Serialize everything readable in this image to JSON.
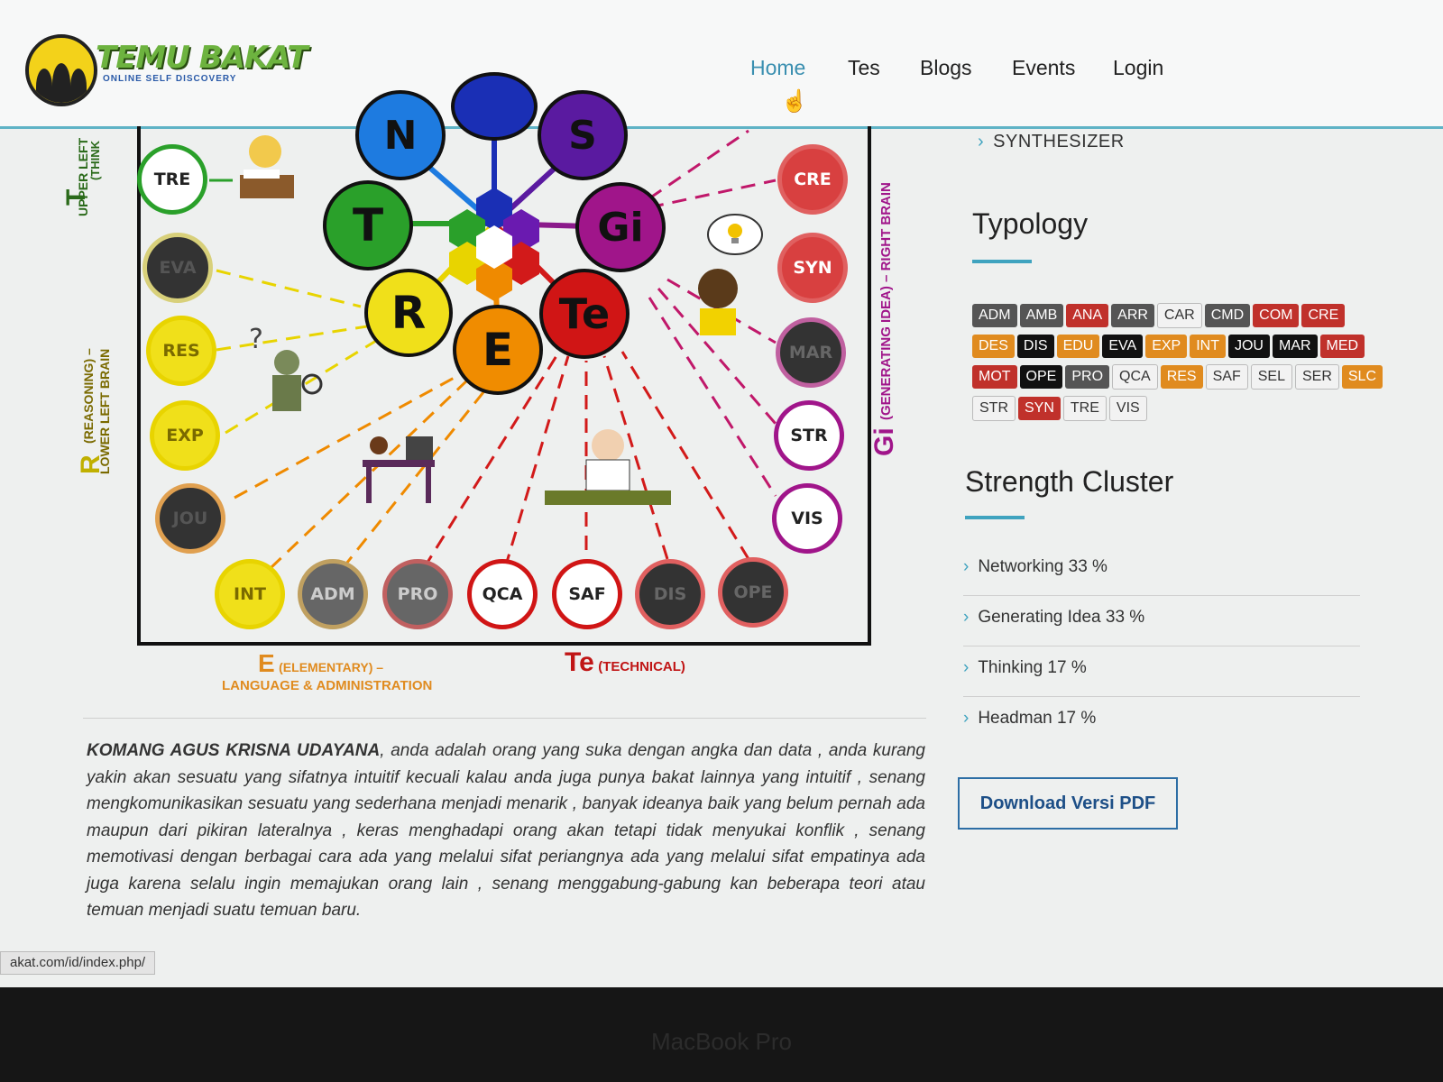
{
  "logo": {
    "title": "TEMU BAKAT",
    "subtitle": "ONLINE SELF DISCOVERY"
  },
  "nav": [
    {
      "label": "Home",
      "active": true
    },
    {
      "label": "Tes"
    },
    {
      "label": "Blogs"
    },
    {
      "label": "Events"
    },
    {
      "label": "Login"
    }
  ],
  "diagram": {
    "big_circles": {
      "T": "T",
      "R": "R",
      "E": "E",
      "Te": "Te",
      "Gi": "Gi",
      "N": "N",
      "S": "S"
    },
    "small_circles": {
      "TRE": "TRE",
      "EVA": "EVA",
      "RES": "RES",
      "EXP": "EXP",
      "JOU": "JOU",
      "INT": "INT",
      "ADM": "ADM",
      "PRO": "PRO",
      "QCA": "QCA",
      "SAF": "SAF",
      "DIS": "DIS",
      "OPE": "OPE",
      "CRE": "CRE",
      "SYN": "SYN",
      "MAR": "MAR",
      "STR": "STR",
      "VIS": "VIS"
    },
    "labels": {
      "t_letter": "T",
      "t_paren": "(THINK",
      "t_upper": "UPPER LEFT",
      "r_letter": "R",
      "r_paren": "(REASONING) –",
      "r_lower": "LOWER LEFT BRAIN",
      "e_letter": "E",
      "e_paren": "(ELEMENTARY) –",
      "e_lang": "LANGUAGE & ADMINISTRATION",
      "te_letter": "Te",
      "te_paren": "(TECHNICAL)",
      "gi_letter": "Gi",
      "gi_paren": "(GENERATING IDEA) – RIGHT BRAIN"
    }
  },
  "sidebar": {
    "synth": "SYNTHESIZER",
    "typology_title": "Typology",
    "tags": [
      {
        "label": "ADM",
        "style": "gray"
      },
      {
        "label": "AMB",
        "style": "gray"
      },
      {
        "label": "ANA",
        "style": "red"
      },
      {
        "label": "ARR",
        "style": "gray"
      },
      {
        "label": "CAR",
        "style": "light"
      },
      {
        "label": "CMD",
        "style": "gray"
      },
      {
        "label": "COM",
        "style": "red"
      },
      {
        "label": "CRE",
        "style": "red"
      },
      {
        "label": "DES",
        "style": "orange"
      },
      {
        "label": "DIS",
        "style": "black"
      },
      {
        "label": "EDU",
        "style": "orange"
      },
      {
        "label": "EVA",
        "style": "black"
      },
      {
        "label": "EXP",
        "style": "orange"
      },
      {
        "label": "INT",
        "style": "orange"
      },
      {
        "label": "JOU",
        "style": "black"
      },
      {
        "label": "MAR",
        "style": "black"
      },
      {
        "label": "MED",
        "style": "red"
      },
      {
        "label": "MOT",
        "style": "red"
      },
      {
        "label": "OPE",
        "style": "black"
      },
      {
        "label": "PRO",
        "style": "gray"
      },
      {
        "label": "QCA",
        "style": "light"
      },
      {
        "label": "RES",
        "style": "orange"
      },
      {
        "label": "SAF",
        "style": "light"
      },
      {
        "label": "SEL",
        "style": "light"
      },
      {
        "label": "SER",
        "style": "light"
      },
      {
        "label": "SLC",
        "style": "orange"
      },
      {
        "label": "STR",
        "style": "light"
      },
      {
        "label": "SYN",
        "style": "red"
      },
      {
        "label": "TRE",
        "style": "light"
      },
      {
        "label": "VIS",
        "style": "light"
      }
    ],
    "cluster_title": "Strength Cluster",
    "clusters": [
      "Networking 33 %",
      "Generating Idea 33 %",
      "Thinking 17 %",
      "Headman 17 %"
    ],
    "download": "Download Versi PDF"
  },
  "paragraph": {
    "name": "KOMANG AGUS KRISNA UDAYANA",
    "text": ", anda adalah orang yang suka dengan angka dan data , anda kurang yakin akan sesuatu yang sifatnya intuitif kecuali kalau anda juga punya bakat lainnya yang intuitif , senang mengkomunikasikan sesuatu yang sederhana menjadi menarik , banyak ideanya baik yang belum pernah ada maupun dari pikiran lateralnya , keras menghadapi orang akan tetapi tidak menyukai konflik , senang memotivasi dengan berbagai cara ada yang melalui sifat periangnya ada yang melalui sifat empatinya ada juga karena selalu ingin memajukan orang lain , senang menggabung-gabung kan beberapa teori atau temuan menjadi suatu temuan baru."
  },
  "status_url": "akat.com/id/index.php/",
  "bezel_label": "MacBook Pro"
}
